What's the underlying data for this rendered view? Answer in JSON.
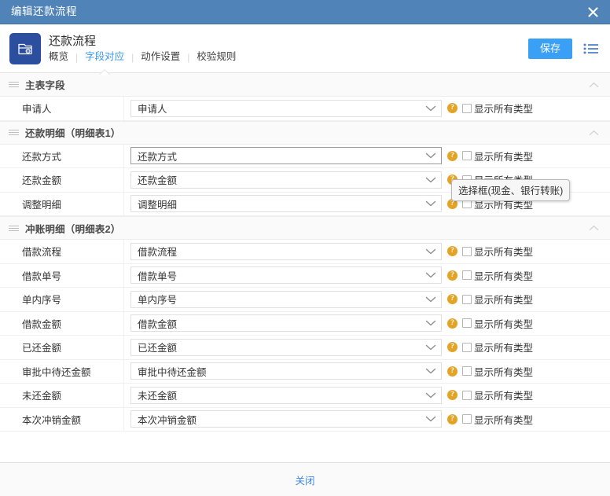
{
  "window": {
    "title": "编辑还款流程",
    "close_icon": "close-icon"
  },
  "appbar": {
    "app_title": "还款流程",
    "app_icon": "document-lock-icon",
    "tabs": [
      {
        "label": "概览",
        "active": false
      },
      {
        "label": "字段对应",
        "active": true
      },
      {
        "label": "动作设置",
        "active": false
      },
      {
        "label": "校验规则",
        "active": false
      }
    ],
    "separator": "|",
    "save_label": "保存",
    "menu_icon": "list-menu-icon"
  },
  "checkbox_label": "显示所有类型",
  "help_glyph": "?",
  "tooltip": {
    "text": "选择框(现金、银行转账)",
    "attached_to": "还款金额"
  },
  "sections": [
    {
      "title": "主表字段",
      "grip_icon": "drag-grip-icon",
      "chevron_icon": "chevron-up-icon",
      "rows": [
        {
          "label": "申请人",
          "value": "申请人",
          "focused": false,
          "checked": false
        }
      ]
    },
    {
      "title": "还款明细（明细表1）",
      "grip_icon": "drag-grip-icon",
      "chevron_icon": "chevron-up-icon",
      "rows": [
        {
          "label": "还款方式",
          "value": "还款方式",
          "focused": true,
          "checked": false
        },
        {
          "label": "还款金额",
          "value": "还款金额",
          "focused": false,
          "checked": false
        },
        {
          "label": "调整明细",
          "value": "调整明细",
          "focused": false,
          "checked": false
        }
      ]
    },
    {
      "title": "冲账明细（明细表2）",
      "grip_icon": "drag-grip-icon",
      "chevron_icon": "chevron-up-icon",
      "rows": [
        {
          "label": "借款流程",
          "value": "借款流程",
          "focused": false,
          "checked": false
        },
        {
          "label": "借款单号",
          "value": "借款单号",
          "focused": false,
          "checked": false
        },
        {
          "label": "单内序号",
          "value": "单内序号",
          "focused": false,
          "checked": false
        },
        {
          "label": "借款金额",
          "value": "借款金额",
          "focused": false,
          "checked": false
        },
        {
          "label": "已还金额",
          "value": "已还金额",
          "focused": false,
          "checked": false
        },
        {
          "label": "审批中待还金额",
          "value": "审批中待还金额",
          "focused": false,
          "checked": false
        },
        {
          "label": "未还金额",
          "value": "未还金额",
          "focused": false,
          "checked": false
        },
        {
          "label": "本次冲销金额",
          "value": "本次冲销金额",
          "focused": false,
          "checked": false
        }
      ]
    }
  ],
  "footer": {
    "close_label": "关闭"
  },
  "colors": {
    "titlebar": "#5083b8",
    "accent_blue": "#3aa0f5",
    "tab_active": "#3a9ae8",
    "app_icon_bg": "#2b4f9e",
    "help_orange": "#e3a325",
    "link_blue": "#3a86e8"
  }
}
